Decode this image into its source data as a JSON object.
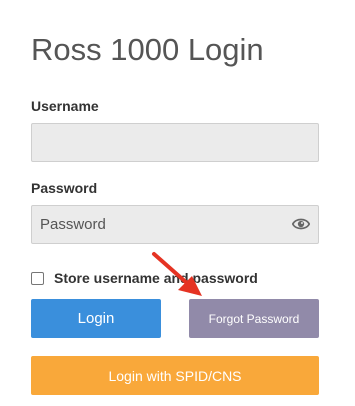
{
  "page": {
    "title": "Ross 1000 Login"
  },
  "form": {
    "username_label": "Username",
    "username_value": "",
    "username_placeholder": "",
    "password_label": "Password",
    "password_placeholder": "Password",
    "show_password_icon": "eye-icon",
    "store_credentials_label": "Store username and password",
    "store_credentials_checked": false
  },
  "buttons": {
    "login_label": "Login",
    "forgot_password_label": "Forgot Password",
    "spid_label": "Login with SPID/CNS"
  },
  "colors": {
    "login_button": "#3a8fdc",
    "forgot_button": "#918aa9",
    "spid_button": "#f9a83a",
    "annotation_arrow": "#e53323"
  },
  "annotation": {
    "type": "red-arrow",
    "points_to": "forgot-password-button"
  }
}
